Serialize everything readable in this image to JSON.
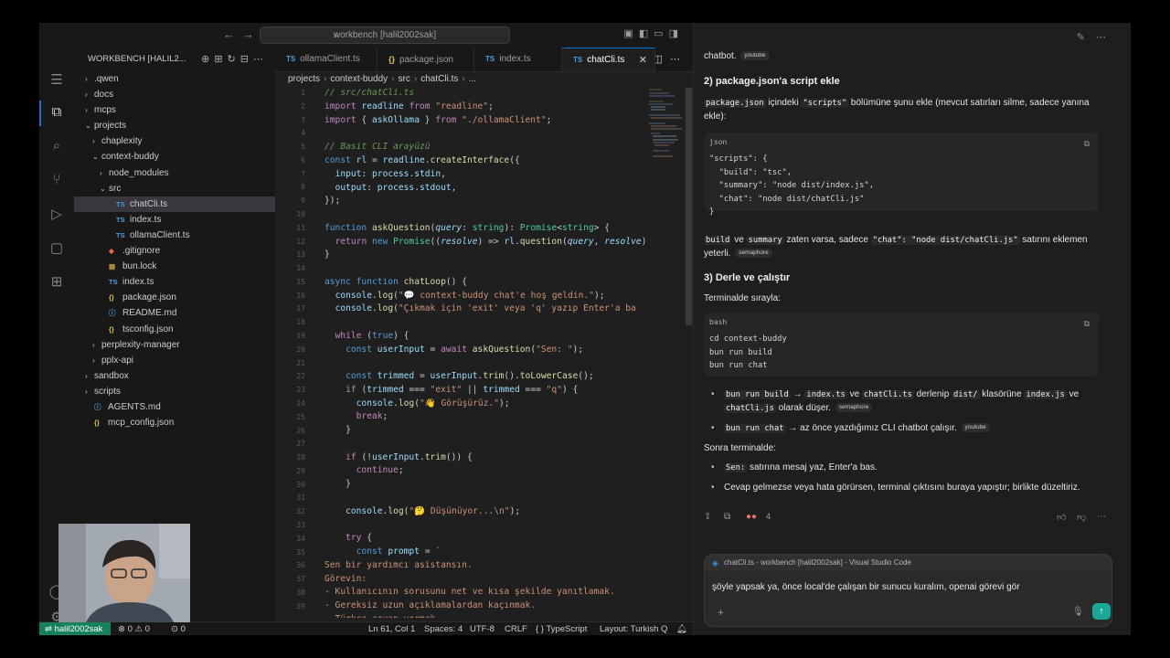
{
  "vscode": {
    "search_text": "workbench [halil2002sak]",
    "explorer_title": "WORKBENCH [HALIL2...",
    "tree": [
      {
        "label": ".qwen",
        "type": "folder",
        "depth": 1,
        "open": false
      },
      {
        "label": "docs",
        "type": "folder",
        "depth": 1,
        "open": false
      },
      {
        "label": "mcps",
        "type": "folder",
        "depth": 1,
        "open": false
      },
      {
        "label": "projects",
        "type": "folder",
        "depth": 1,
        "open": true
      },
      {
        "label": "chaplexity",
        "type": "folder",
        "depth": 2,
        "open": false
      },
      {
        "label": "context-buddy",
        "type": "folder",
        "depth": 2,
        "open": true
      },
      {
        "label": "node_modules",
        "type": "folder",
        "depth": 3,
        "open": false
      },
      {
        "label": "src",
        "type": "folder",
        "depth": 3,
        "open": true
      },
      {
        "label": "chatCli.ts",
        "type": "ts",
        "depth": 4,
        "selected": true
      },
      {
        "label": "index.ts",
        "type": "ts",
        "depth": 4
      },
      {
        "label": "ollamaClient.ts",
        "type": "ts",
        "depth": 4
      },
      {
        "label": ".gitignore",
        "type": "git",
        "depth": 3
      },
      {
        "label": "bun.lock",
        "type": "lock",
        "depth": 3
      },
      {
        "label": "index.ts",
        "type": "ts",
        "depth": 3
      },
      {
        "label": "package.json",
        "type": "json",
        "depth": 3
      },
      {
        "label": "README.md",
        "type": "md",
        "depth": 3
      },
      {
        "label": "tsconfig.json",
        "type": "json",
        "depth": 3
      },
      {
        "label": "perplexity-manager",
        "type": "folder",
        "depth": 2,
        "open": false
      },
      {
        "label": "pplx-api",
        "type": "folder",
        "depth": 2,
        "open": false
      },
      {
        "label": "sandbox",
        "type": "folder",
        "depth": 1,
        "open": false
      },
      {
        "label": "scripts",
        "type": "folder",
        "depth": 1,
        "open": false
      },
      {
        "label": "AGENTS.md",
        "type": "md",
        "depth": 1
      },
      {
        "label": "mcp_config.json",
        "type": "json",
        "depth": 1
      }
    ],
    "tabs": [
      {
        "label": "ollamaClient.ts",
        "kind": "TS"
      },
      {
        "label": "package.json",
        "kind": "{}"
      },
      {
        "label": "index.ts",
        "kind": "TS"
      },
      {
        "label": "chatCli.ts",
        "kind": "TS",
        "active": true
      }
    ],
    "breadcrumb": [
      "projects",
      "context-buddy",
      "src",
      "chatCli.ts",
      "..."
    ],
    "gutter_lines": [
      "1",
      "2",
      "3",
      "4",
      "5",
      "6",
      "7",
      "8",
      "9",
      "10",
      "11",
      "12",
      "13",
      "14",
      "15",
      "16",
      "17",
      "18",
      "19",
      "20",
      "21",
      "22",
      "23",
      "24",
      "25",
      "26",
      "27",
      "28",
      "29",
      "30",
      "31",
      "32",
      "33",
      "34",
      "35",
      "36",
      "37",
      "38",
      "39"
    ],
    "status": {
      "remote": "halil2002sak",
      "problems": "⊗ 0 ⚠ 0",
      "ports": "0",
      "position": "Ln 61, Col 1",
      "spaces": "Spaces: 4",
      "encoding": "UTF-8",
      "eol": "CRLF",
      "language": "TypeScript",
      "layout": "Layout: Turkish Q"
    }
  },
  "chat": {
    "intro_text": "chatbot.",
    "intro_pill": "youtube",
    "step2_title": "2) package.json'a script ekle",
    "step2_code": "package.json",
    "step2_scripts": "\"scripts\"",
    "step2_text_a": " içindeki ",
    "step2_text_b": " bölümüne şunu ekle (mevcut satırları silme, sadece yanına ekle):",
    "json_lang": "json",
    "json_code": "\"scripts\": {\n  \"build\": \"tsc\",\n  \"summary\": \"node dist/index.js\",\n  \"chat\": \"node dist/chatCli.js\"\n}",
    "after_json_build": "build",
    "after_json_ve": " ve ",
    "after_json_summary": "summary",
    "after_json_a": " zaten varsa, sadece ",
    "after_json_chat": "\"chat\": \"node dist/chatCli.js\"",
    "after_json_b": " satırını eklemen",
    "after_json_c": "yeterli.",
    "after_json_pill": "semaphore",
    "step3_title": "3) Derle ve çalıştır",
    "step3_intro": "Terminalde sırayla:",
    "bash_lang": "bash",
    "bash_code": "cd context-buddy\nbun run build\nbun run chat",
    "bullet1_code1": "bun run build",
    "bullet1_arrow": " → ",
    "bullet1_code2": "index.ts",
    "bullet1_ve": " ve ",
    "bullet1_code3": "chatCli.ts",
    "bullet1_a": " derlenip ",
    "bullet1_code4": "dist/",
    "bullet1_b": " klasörüne ",
    "bullet1_code5": "index.js",
    "bullet1_ve2": " ve",
    "bullet1_code6": "chatCli.js",
    "bullet1_c": " olarak düşer.",
    "bullet1_pill": "semaphore",
    "bullet2_code": "bun run chat",
    "bullet2_text": " → az önce yazdığımız CLI chatbot çalışır.",
    "bullet2_pill": "youtube",
    "then_text": "Sonra terminalde:",
    "bullet3_code": "Sen:",
    "bullet3_text": " satırına mesaj yaz, Enter'a bas.",
    "bullet4_text": "Cevap gelmezse veya hata görürsen, terminal çıktısını buraya yapıştır; birlikte düzeltiriz.",
    "sources_count": "4",
    "context_label": "chatCli.ts - workbench [halil2002sak] - Visual Studio Code",
    "input_value": "şöyle yapsak ya, önce local'de çalışan bir sunucu kuralım, openai görevi gör"
  },
  "colors": {
    "accent_blue": "#0078d4",
    "remote_green": "#16825d",
    "send_teal": "#19a896"
  }
}
